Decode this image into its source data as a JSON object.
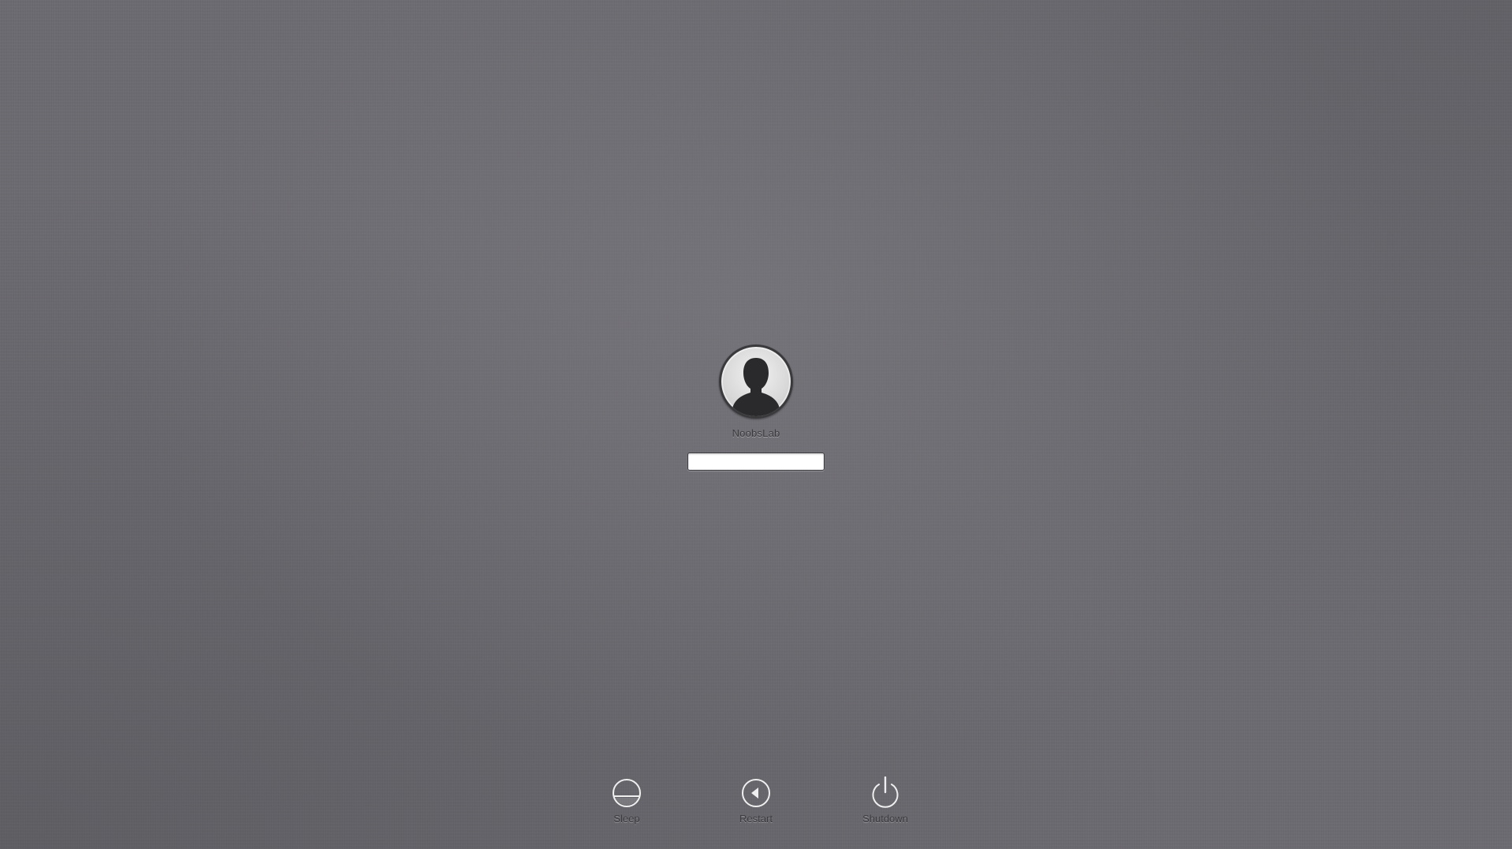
{
  "user": {
    "name": "NoobsLab",
    "avatar_icon": "user-silhouette-icon"
  },
  "password": {
    "value": "",
    "placeholder": ""
  },
  "actions": {
    "sleep": {
      "label": "Sleep",
      "icon": "sleep-icon"
    },
    "restart": {
      "label": "Restart",
      "icon": "restart-icon"
    },
    "shutdown": {
      "label": "Shutdown",
      "icon": "power-icon"
    }
  },
  "colors": {
    "background": "#6b6a70",
    "text": "#3b3b3e",
    "icon_stroke": "#efefef"
  }
}
